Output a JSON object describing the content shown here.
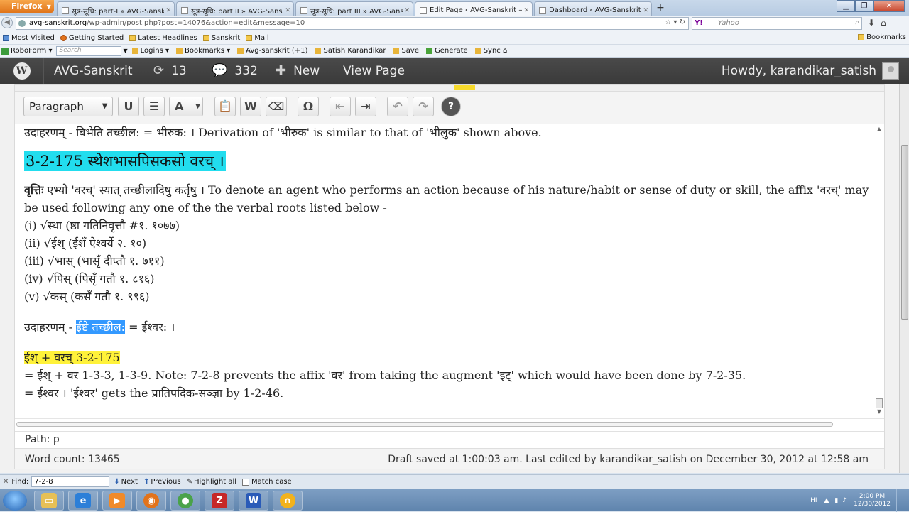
{
  "browser": {
    "app_button": "Firefox",
    "tabs": [
      {
        "label": "सूत्र-सूचि: part-I » AVG-Sanskrit",
        "active": false
      },
      {
        "label": "सूत्र-सूचि: part II » AVG-Sanskrit",
        "active": false
      },
      {
        "label": "सूत्र-सूचि: part III » AVG-Sanskrit",
        "active": false
      },
      {
        "label": "Edit Page ‹ AVG-Sanskrit — ...",
        "active": true
      },
      {
        "label": "Dashboard ‹ AVG-Sanskrit — ...",
        "active": false
      }
    ],
    "new_tab": "+",
    "url_host": "avg-sanskrit.org",
    "url_path": "/wp-admin/post.php?post=14076&action=edit&message=10",
    "search_engine": "Y!",
    "search_placeholder": "Yahoo",
    "bookmarks": [
      "Most Visited",
      "Getting Started",
      "Latest Headlines",
      "Sanskrit",
      "Mail"
    ],
    "bookmarks_menu": "Bookmarks",
    "toolbar_items": {
      "roboform": "RoboForm",
      "search_placeholder": "Search",
      "logins": "Logins",
      "bookmarks": "Bookmarks",
      "avg": "Avg-sanskrit",
      "avg_count": "(+1)",
      "satish": "Satish Karandikar",
      "save": "Save",
      "generate": "Generate",
      "sync": "Sync"
    }
  },
  "wp_admin_bar": {
    "logo": "W",
    "site_name": "AVG-Sanskrit",
    "updates_count": "13",
    "comments_count": "332",
    "new_label": "New",
    "view_page": "View Page",
    "howdy": "Howdy, karandikar_satish"
  },
  "editor": {
    "format_select": "Paragraph",
    "toolbar_icons": [
      "bold-underline",
      "justify",
      "text-color",
      "paste-text",
      "paste-word",
      "clear-formatting",
      "special-char",
      "outdent",
      "indent",
      "undo",
      "redo",
      "help"
    ],
    "content": {
      "line1": "उदाहरणम् - बिभेति तच्छील: = भीरुक: । Derivation of 'भीरुक' is similar to that of 'भीलुक' shown above.",
      "heading": "3-2-175 स्थेशभासपिसकसो वरच् ।",
      "vritti_label": "वृत्तिः",
      "vritti_text": " एभ्यो 'वरच्' स्यात् तच्छीलादिषु कर्तृषु । To denote an agent who performs an action because of his nature/habit or sense of duty or skill, the affix 'वरच्' may be used following any one of the the verbal roots listed below -",
      "roots": [
        "(i) √स्था (ष्ठा गतिनिवृत्तौ #१. १०७७)",
        "(ii) √ईश् (ईशँ ऐश्वर्ये २. १०)",
        "(iii) √भास् (भासृँ दीप्तौ १. ७११)",
        "(iv) √पिस् (पिसृँ गतौ १. ८१६)",
        "(v) √कस् (कसँ गतौ १. ९९६)"
      ],
      "example_prefix": "उदाहरणम् - ",
      "example_selected": "ईष्टे तच्छील:",
      "example_suffix": " = ईश्वर: ।",
      "derivation_title": "ईश् + वरच् 3-2-175",
      "derivation_line1": "= ईश् + वर 1-3-3, 1-3-9. Note: 7-2-8 prevents the affix 'वर' from taking the augment 'इट्' which would have been done by 7-2-35.",
      "derivation_line2": "= ईश्वर । 'ईश्वर' gets the प्रातिपदिक-सञ्ज्ञा by 1-2-46."
    },
    "path": "Path: p",
    "word_count": "Word count: 13465",
    "draft_status": "Draft saved at 1:00:03 am. Last edited by karandikar_satish on December 30, 2012 at 12:58 am"
  },
  "find_bar": {
    "label": "Find:",
    "value": "7-2-8",
    "next": "Next",
    "previous": "Previous",
    "highlight_all": "Highlight all",
    "match_case": "Match case"
  },
  "taskbar": {
    "apps": [
      "explorer",
      "ie",
      "media-player",
      "firefox",
      "chrome",
      "filezilla",
      "word",
      "audio"
    ],
    "lang": "HI",
    "time": "2:00 PM",
    "date": "12/30/2012"
  },
  "colors": {
    "heading_highlight": "#22ddee",
    "selection": "#3399ff",
    "yellow_highlight": "#fff23a",
    "wp_bar": "#464646"
  }
}
